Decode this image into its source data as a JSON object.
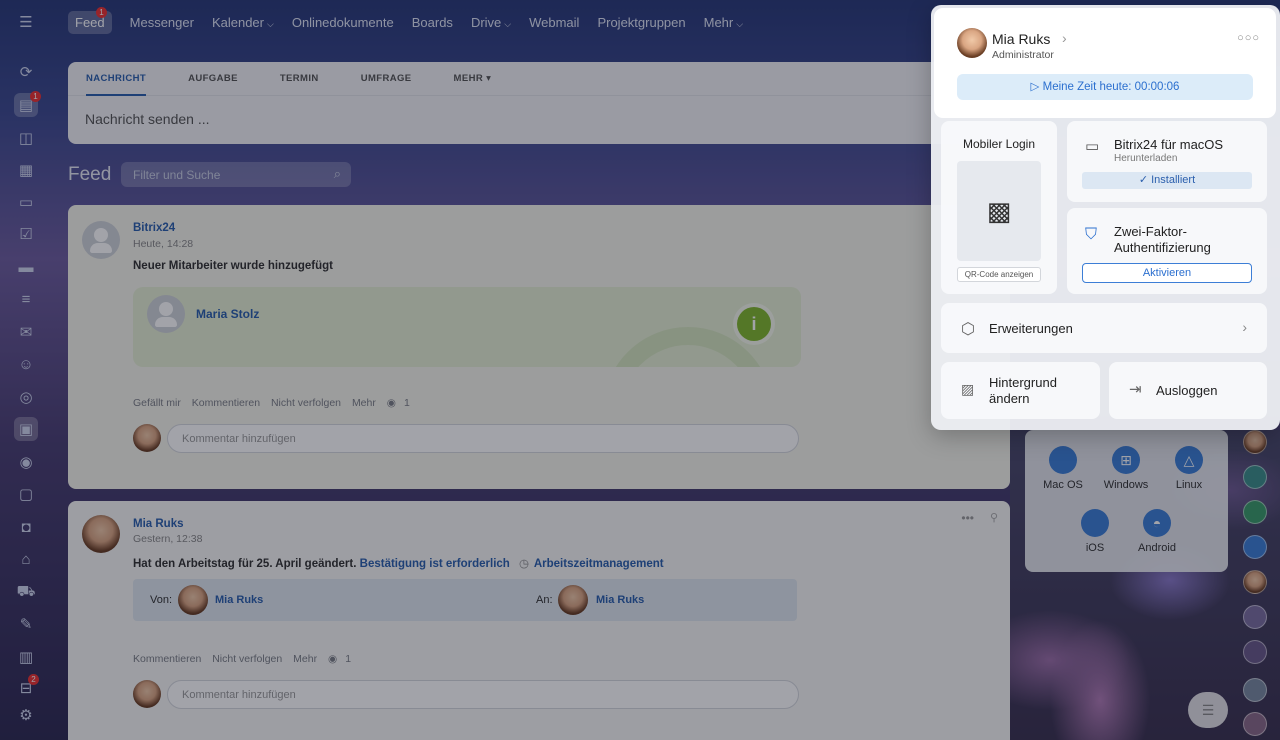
{
  "topnav": {
    "items": [
      {
        "label": "Feed",
        "badge": "1",
        "active": true
      },
      {
        "label": "Messenger"
      },
      {
        "label": "Kalender",
        "caret": true
      },
      {
        "label": "Onlinedokumente"
      },
      {
        "label": "Boards"
      },
      {
        "label": "Drive",
        "caret": true
      },
      {
        "label": "Webmail"
      },
      {
        "label": "Projektgruppen"
      },
      {
        "label": "Mehr",
        "caret": true
      }
    ]
  },
  "rail": {
    "menu_icon": "menu-icon",
    "feed_badge": "1",
    "bottom_badge": "2"
  },
  "composer": {
    "tabs": [
      "NACHRICHT",
      "AUFGABE",
      "TERMIN",
      "UMFRAGE",
      "MEHR"
    ],
    "placeholder": "Nachricht senden ..."
  },
  "feed": {
    "title": "Feed",
    "filter_placeholder": "Filter und Suche"
  },
  "post1": {
    "author": "Bitrix24",
    "time": "Heute, 14:28",
    "text": "Neuer Mitarbeiter wurde hinzugefügt",
    "new_user": "Maria Stolz",
    "actions": [
      "Gefällt mir",
      "Kommentieren",
      "Nicht verfolgen",
      "Mehr"
    ],
    "views": "1",
    "comment_placeholder": "Kommentar hinzufügen"
  },
  "post2": {
    "author": "Mia Ruks",
    "time": "Gestern, 12:38",
    "text": "Hat den Arbeitstag für 25. April geändert.",
    "confirm_link": "Bestätigung ist erforderlich",
    "tag": "Arbeitszeitmanagement",
    "from_label": "Von:",
    "from_name": "Mia Ruks",
    "to_label": "An:",
    "to_name": "Mia Ruks",
    "actions": [
      "Kommentieren",
      "Nicht verfolgen",
      "Mehr"
    ],
    "views": "1",
    "comment_placeholder": "Kommentar hinzufügen"
  },
  "downloads": {
    "items": [
      "Mac OS",
      "Windows",
      "Linux",
      "iOS",
      "Android"
    ]
  },
  "popup": {
    "user_name": "Mia Ruks",
    "role": "Administrator",
    "time_today": "Meine Zeit heute: 00:00:06",
    "mobile_login": "Mobiler Login",
    "qr_button": "QR-Code anzeigen",
    "mac_title": "Bitrix24 für macOS",
    "mac_sub": "Herunterladen",
    "installed": "Installiert",
    "tfa_title": "Zwei-Faktor-Authentifizierung",
    "tfa_button": "Aktivieren",
    "extensions": "Erweiterungen",
    "background_line1": "Hintergrund",
    "background_line2": "ändern",
    "logout": "Ausloggen"
  },
  "colors": {
    "accent": "#2b5fad",
    "badge": "#e33333",
    "success": "#82b82e"
  }
}
